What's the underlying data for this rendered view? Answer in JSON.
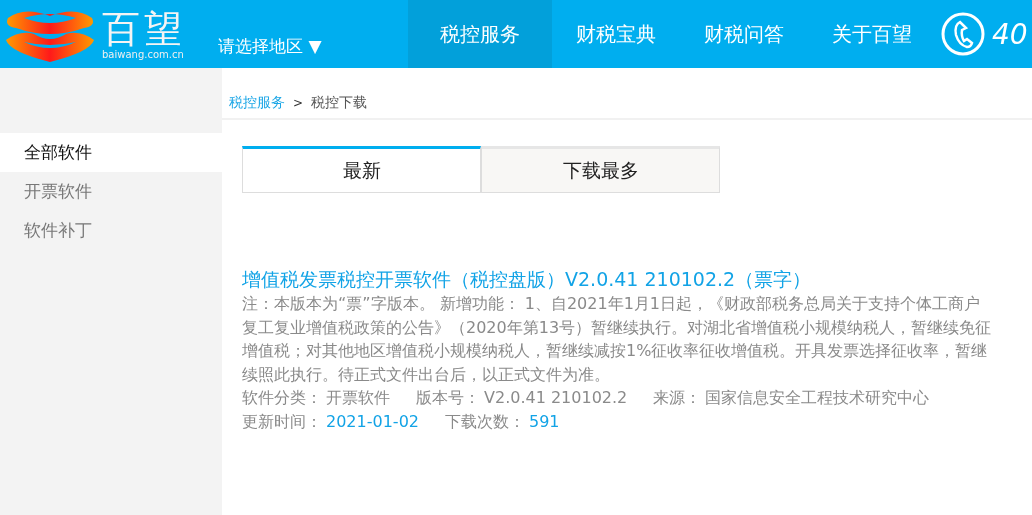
{
  "header": {
    "logo": {
      "name": "百望",
      "domain": "baiwang.com.cn"
    },
    "region": {
      "label": "请选择地区",
      "caret": "▼"
    },
    "nav": [
      {
        "label": "税控服务",
        "selected": true
      },
      {
        "label": "财税宝典",
        "selected": false
      },
      {
        "label": "财税问答",
        "selected": false
      },
      {
        "label": "关于百望",
        "selected": false
      }
    ],
    "phone": {
      "text": "40"
    }
  },
  "sidebar": {
    "items": [
      {
        "label": "全部软件",
        "selected": true
      },
      {
        "label": "开票软件",
        "selected": false
      },
      {
        "label": "软件补丁",
        "selected": false
      }
    ]
  },
  "breadcrumb": {
    "parent": "税控服务",
    "separator": ">",
    "current": "税控下载"
  },
  "tabs": [
    {
      "label": "最新",
      "selected": true
    },
    {
      "label": "下载最多",
      "selected": false
    }
  ],
  "article": {
    "title": "增值税发票税控开票软件（税控盘版）V2.0.41 210102.2（票字）",
    "description": "注：本版本为“票”字版本。 新增功能： 1、自2021年1月1日起，《财政部税务总局关于支持个体工商户复工复业增值税政策的公告》（2020年第13号）暂继续执行。对湖北省增值税小规模纳税人，暂继续免征增值税；对其他地区增值税小规模纳税人，暂继续减按1%征收率征收增值税。开具发票选择征收率，暂继续照此执行。待正式文件出台后，以正式文件为准。",
    "meta": [
      {
        "label": "软件分类：",
        "value": "开票软件",
        "kind": "plain"
      },
      {
        "label": "版本号：",
        "value": "V2.0.41 210102.2",
        "kind": "plain"
      },
      {
        "label": "来源：",
        "value": "国家信息安全工程技术研究中心",
        "kind": "plain"
      }
    ],
    "stats": [
      {
        "label": "更新时间：",
        "value": "2021-01-02",
        "kind": "highlight"
      },
      {
        "label": "下载次数：",
        "value": "591",
        "kind": "highlight"
      }
    ]
  }
}
